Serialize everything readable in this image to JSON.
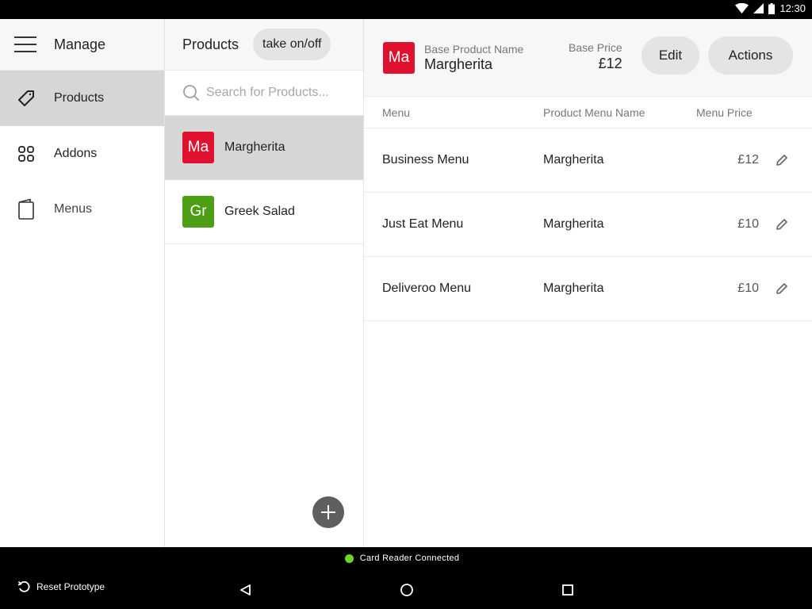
{
  "status_bar": {
    "time": "12:30",
    "icons": [
      "wifi-icon",
      "cellular-signal-icon",
      "battery-icon"
    ]
  },
  "sidebar": {
    "title": "Manage",
    "menu_icon": "hamburger-menu-icon",
    "items": [
      {
        "label": "Products",
        "icon": "tag-icon",
        "active": true
      },
      {
        "label": "Addons",
        "icon": "grid-icon",
        "active": false
      },
      {
        "label": "Menus",
        "icon": "menu-book-icon",
        "active": false
      }
    ]
  },
  "products_panel": {
    "title": "Products",
    "toggle_button": "take on/off",
    "search": {
      "placeholder": "Search for Products...",
      "value": ""
    },
    "items": [
      {
        "initials": "Ma",
        "name": "Margherita",
        "color": "#e0102f",
        "active": true
      },
      {
        "initials": "Gr",
        "name": "Greek Salad",
        "color": "#4c9f15",
        "active": false
      }
    ],
    "add_button_icon": "plus-icon"
  },
  "detail": {
    "avatar": {
      "initials": "Ma",
      "color": "#e0102f"
    },
    "base_product_name_label": "Base Product Name",
    "base_product_name": "Margherita",
    "base_price_label": "Base Price",
    "base_price": "£12",
    "edit_button": "Edit",
    "actions_button": "Actions",
    "table": {
      "headers": [
        "Menu",
        "Product Menu Name",
        "Menu Price"
      ],
      "rows": [
        {
          "menu": "Business Menu",
          "product_menu_name": "Margherita",
          "price": "£12"
        },
        {
          "menu": "Just Eat Menu",
          "product_menu_name": "Margherita",
          "price": "£10"
        },
        {
          "menu": "Deliveroo Menu",
          "product_menu_name": "Margherita",
          "price": "£10"
        }
      ]
    }
  },
  "bottom_bar": {
    "card_reader_status": "Card Reader Connected",
    "status_color": "#6dd331",
    "reset_label": "Reset Prototype"
  }
}
